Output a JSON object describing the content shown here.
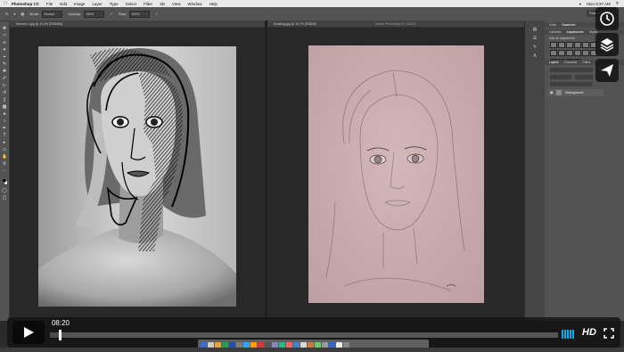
{
  "menubar": {
    "app_name": "Photoshop CC",
    "items": [
      "File",
      "Edit",
      "Image",
      "Layer",
      "Type",
      "Select",
      "Filter",
      "3D",
      "View",
      "Window",
      "Help"
    ],
    "time": "Mon 9:37 AM"
  },
  "options": {
    "mode_label": "Mode:",
    "mode_value": "Normal",
    "opacity_label": "Opacity:",
    "opacity_value": "100%",
    "flow_label": "Flow:",
    "flow_value": "100%",
    "workspace": "Essentials"
  },
  "documents": {
    "left_tab": "Women-1.jpg @ 13.3% (RGB/8#)",
    "right_tab": "Drawing.jpg @ 16.7% (RGB/8)",
    "center_title": "Adobe Photoshop CC 2015.5"
  },
  "panels": {
    "tabs_top": [
      "Color",
      "Swatches"
    ],
    "tabs_mid": [
      "Libraries",
      "Adjustments",
      "Styles"
    ],
    "adjust_hint": "Add an adjustment",
    "tabs_layers": [
      "Layers",
      "Channels",
      "Paths"
    ],
    "layer_name": "Background"
  },
  "player": {
    "time": "08:20",
    "progress_fraction": 0.02,
    "hd_label": "HD"
  },
  "icons": {
    "watch_later": "clock-icon",
    "collections": "stack-icon",
    "share": "paper-plane-icon",
    "play": "play-icon",
    "volume": "volume-bars-icon",
    "fullscreen": "fullscreen-icon"
  },
  "colors": {
    "accent": "#00adef",
    "ps_panel": "#535353",
    "canvas_bg": "#282828",
    "sketch_paper": "#c8a9ad"
  }
}
